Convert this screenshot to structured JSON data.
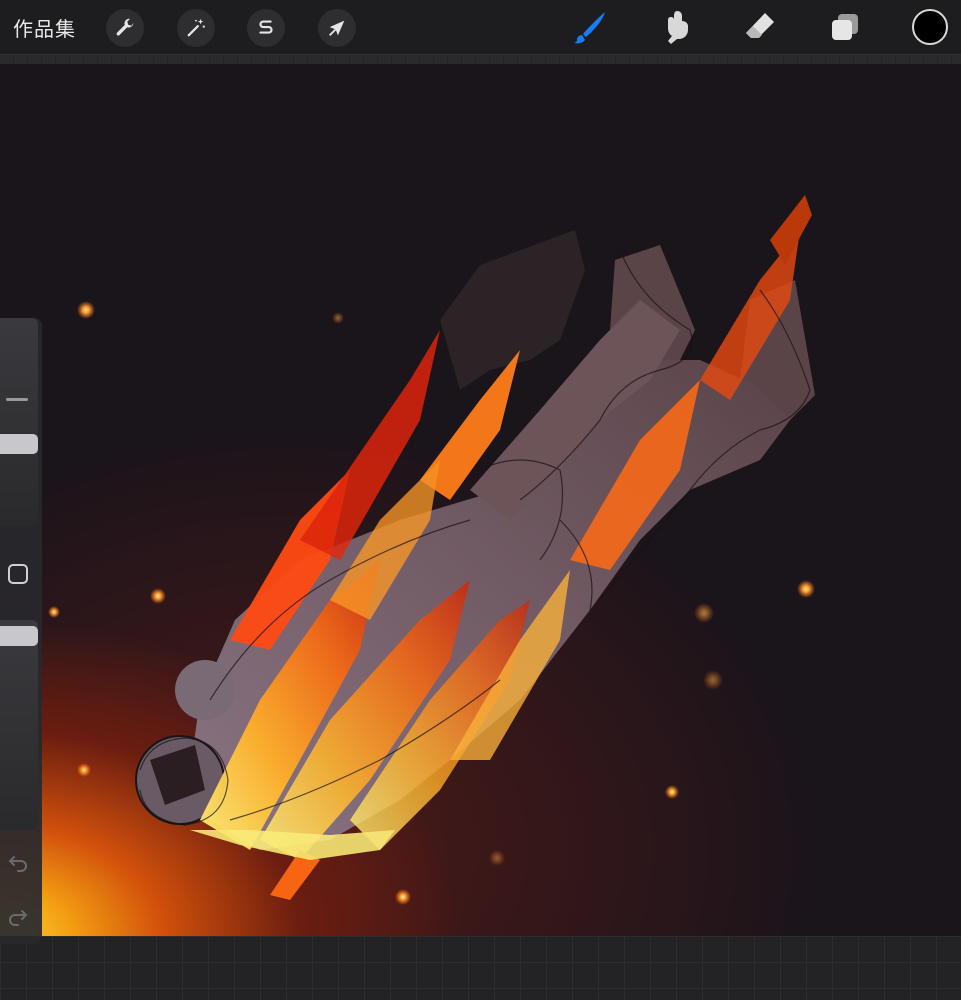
{
  "toolbar": {
    "gallery_label": "作品集",
    "tools_left": [
      {
        "name": "actions",
        "icon": "wrench-icon"
      },
      {
        "name": "adjustments",
        "icon": "magic-wand-icon"
      },
      {
        "name": "selection",
        "icon": "selection-s-icon"
      },
      {
        "name": "transform",
        "icon": "arrow-cursor-icon"
      }
    ],
    "tools_right": [
      {
        "name": "brush",
        "icon": "brush-icon",
        "active": true,
        "color": "#1a7cf5"
      },
      {
        "name": "smudge",
        "icon": "smudge-finger-icon"
      },
      {
        "name": "eraser",
        "icon": "eraser-icon"
      },
      {
        "name": "layers",
        "icon": "layers-icon"
      }
    ],
    "current_color": "#000000"
  },
  "sidebar": {
    "brush_size_level": 0.35,
    "opacity_level": 0.05,
    "modify_button_icon": "square-icon",
    "undo_icon": "undo-icon",
    "redo_icon": "redo-icon"
  }
}
